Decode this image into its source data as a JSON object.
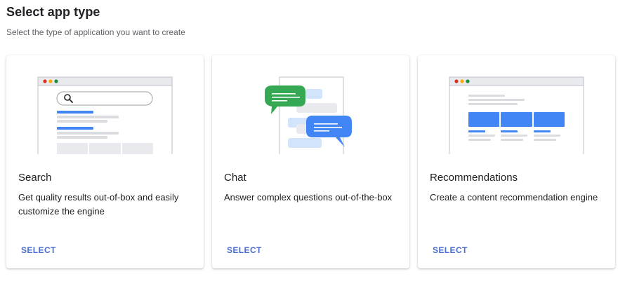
{
  "header": {
    "title": "Select app type",
    "subtitle": "Select the type of application you want to create"
  },
  "cards": [
    {
      "title": "Search",
      "description": "Get quality results out-of-box and easily customize the engine",
      "select_label": "SELECT",
      "illustration": "search-illustration"
    },
    {
      "title": "Chat",
      "description": "Answer complex questions out-of-the-box",
      "select_label": "SELECT",
      "illustration": "chat-illustration"
    },
    {
      "title": "Recommendations",
      "description": "Create a content recommendation engine",
      "select_label": "SELECT",
      "illustration": "recommendations-illustration"
    }
  ],
  "colors": {
    "accent": "#4a6fd1",
    "blue": "#4285f4",
    "green": "#34a853",
    "light_blue": "#d2e3fc",
    "gray": "#e8eaed",
    "dot_red": "#d93025",
    "dot_yellow": "#f9ab00",
    "dot_green": "#1e8e3e"
  }
}
